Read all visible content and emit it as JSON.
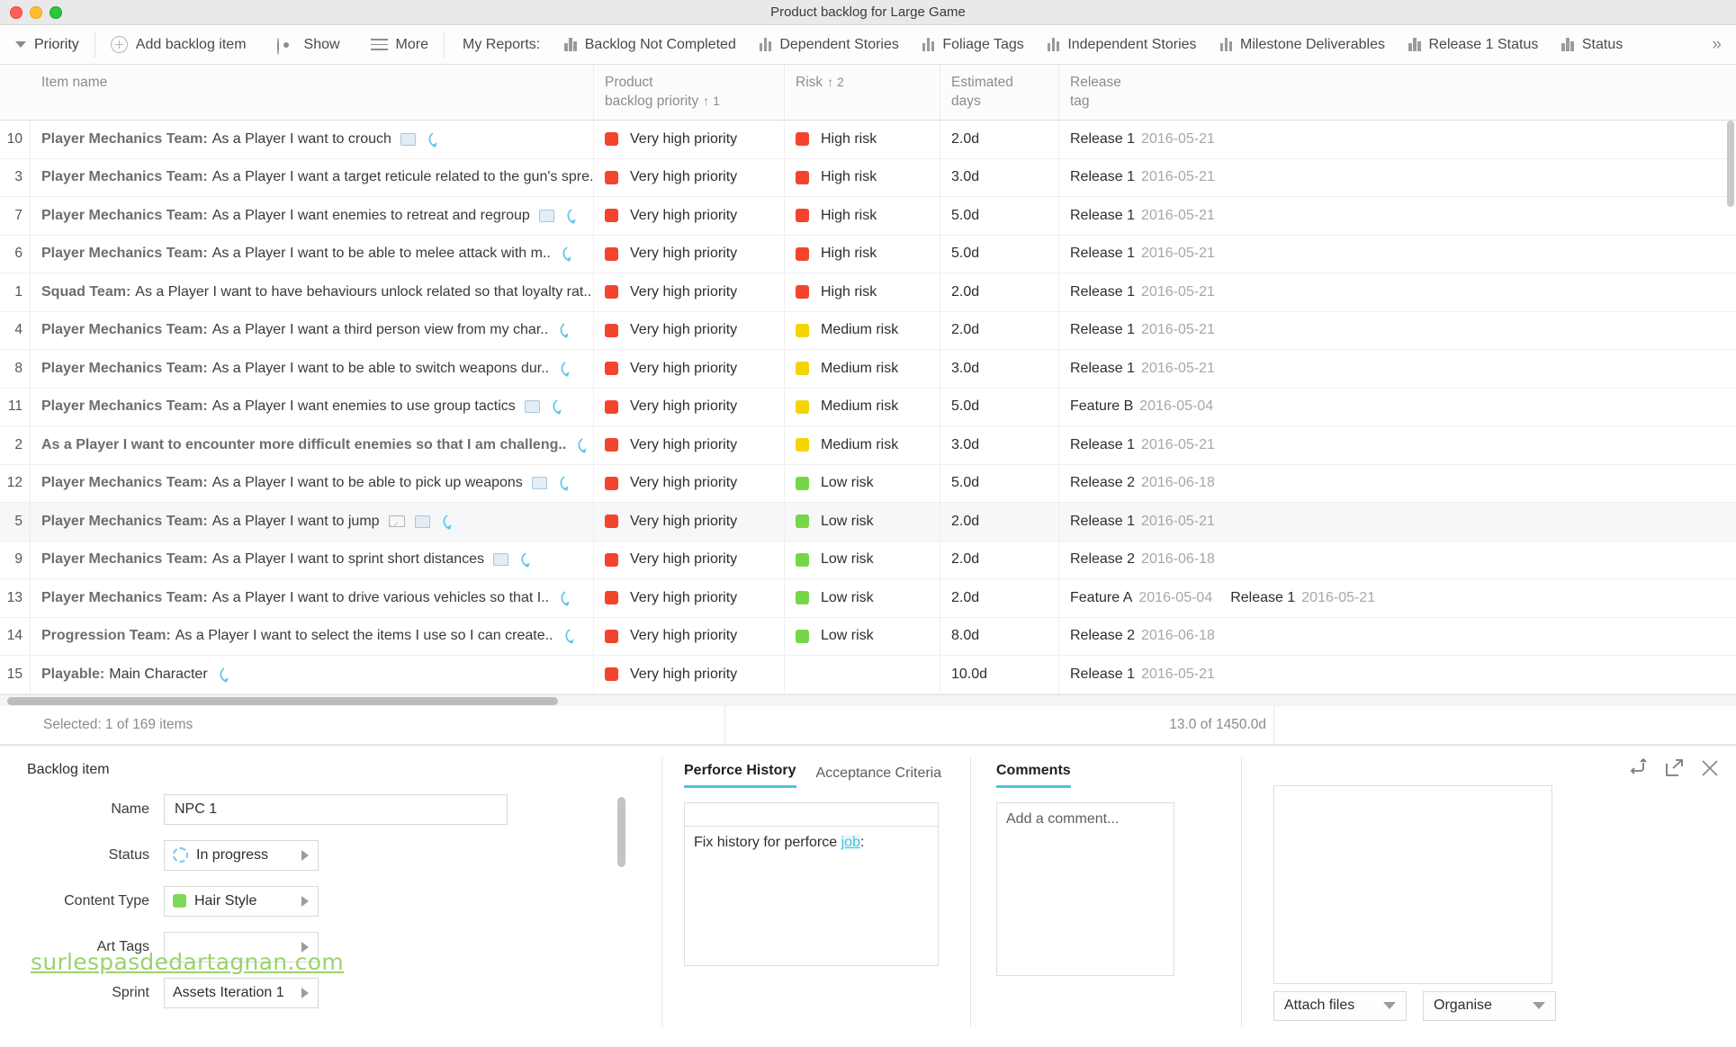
{
  "window": {
    "title": "Product backlog for Large Game"
  },
  "toolbar": {
    "priority_label": "Priority",
    "add_backlog_label": "Add backlog item",
    "show_label": "Show",
    "more_label": "More",
    "my_reports_label": "My Reports:",
    "overflow_label": "»",
    "reports": [
      {
        "label": "Backlog Not Completed"
      },
      {
        "label": "Dependent Stories"
      },
      {
        "label": "Foliage Tags"
      },
      {
        "label": "Independent Stories"
      },
      {
        "label": "Milestone Deliverables"
      },
      {
        "label": "Release 1 Status"
      },
      {
        "label": "Status"
      }
    ]
  },
  "table": {
    "columns": {
      "item_name": "Item name",
      "priority_l1": "Product",
      "priority_l2": "backlog priority",
      "priority_sort": "↑ 1",
      "risk": "Risk",
      "risk_sort": "↑ 2",
      "days_l1": "Estimated",
      "days_l2": "days",
      "release_l1": "Release",
      "release_l2": "tag"
    },
    "colors": {
      "very_high": "#f4442e",
      "high": "#f4442e",
      "medium": "#f5d500",
      "low": "#76d649"
    },
    "rows": [
      {
        "num": "10",
        "prefix": "Player Mechanics Team:",
        "rest": "As a Player I want to crouch",
        "allbold": false,
        "icons": [
          "note-icon",
          "arrow-icon"
        ],
        "priority": "Very high priority",
        "priority_color": "#f4442e",
        "risk": "High risk",
        "risk_color": "#f4442e",
        "days": "2.0d",
        "releases": [
          {
            "name": "Release 1",
            "date": "2016-05-21"
          }
        ]
      },
      {
        "num": "3",
        "prefix": "Player Mechanics Team:",
        "rest": "As a Player I want a target reticule related to the gun's spre..",
        "allbold": false,
        "icons": [],
        "priority": "Very high priority",
        "priority_color": "#f4442e",
        "risk": "High risk",
        "risk_color": "#f4442e",
        "days": "3.0d",
        "releases": [
          {
            "name": "Release 1",
            "date": "2016-05-21"
          }
        ]
      },
      {
        "num": "7",
        "prefix": "Player Mechanics Team:",
        "rest": "As a Player I want enemies to retreat and regroup",
        "allbold": false,
        "icons": [
          "note-icon",
          "arrow-icon"
        ],
        "priority": "Very high priority",
        "priority_color": "#f4442e",
        "risk": "High risk",
        "risk_color": "#f4442e",
        "days": "5.0d",
        "releases": [
          {
            "name": "Release 1",
            "date": "2016-05-21"
          }
        ]
      },
      {
        "num": "6",
        "prefix": "Player Mechanics Team:",
        "rest": "As a Player I want to be able to melee attack with m..",
        "allbold": false,
        "icons": [
          "arrow-icon"
        ],
        "priority": "Very high priority",
        "priority_color": "#f4442e",
        "risk": "High risk",
        "risk_color": "#f4442e",
        "days": "5.0d",
        "releases": [
          {
            "name": "Release 1",
            "date": "2016-05-21"
          }
        ]
      },
      {
        "num": "1",
        "prefix": "Squad Team:",
        "rest": "As a Player I want to have behaviours unlock related so that loyalty rat..",
        "allbold": false,
        "icons": [],
        "priority": "Very high priority",
        "priority_color": "#f4442e",
        "risk": "High risk",
        "risk_color": "#f4442e",
        "days": "2.0d",
        "releases": [
          {
            "name": "Release 1",
            "date": "2016-05-21"
          }
        ]
      },
      {
        "num": "4",
        "prefix": "Player Mechanics Team:",
        "rest": "As a Player I want a third person view from my char..",
        "allbold": false,
        "icons": [
          "arrow-icon"
        ],
        "priority": "Very high priority",
        "priority_color": "#f4442e",
        "risk": "Medium risk",
        "risk_color": "#f5d500",
        "days": "2.0d",
        "releases": [
          {
            "name": "Release 1",
            "date": "2016-05-21"
          }
        ]
      },
      {
        "num": "8",
        "prefix": "Player Mechanics Team:",
        "rest": "As a Player I want to be able to switch weapons dur..",
        "allbold": false,
        "icons": [
          "arrow-icon"
        ],
        "priority": "Very high priority",
        "priority_color": "#f4442e",
        "risk": "Medium risk",
        "risk_color": "#f5d500",
        "days": "3.0d",
        "releases": [
          {
            "name": "Release 1",
            "date": "2016-05-21"
          }
        ]
      },
      {
        "num": "11",
        "prefix": "Player Mechanics Team:",
        "rest": "As a Player I want enemies to use group tactics",
        "allbold": false,
        "icons": [
          "note-icon",
          "arrow-icon"
        ],
        "priority": "Very high priority",
        "priority_color": "#f4442e",
        "risk": "Medium risk",
        "risk_color": "#f5d500",
        "days": "5.0d",
        "releases": [
          {
            "name": "Feature B",
            "date": "2016-05-04"
          }
        ]
      },
      {
        "num": "2",
        "prefix": "",
        "rest": "As a Player I want to encounter more difficult enemies so that I am challeng..",
        "allbold": true,
        "icons": [
          "arrow-icon"
        ],
        "priority": "Very high priority",
        "priority_color": "#f4442e",
        "risk": "Medium risk",
        "risk_color": "#f5d500",
        "days": "3.0d",
        "releases": [
          {
            "name": "Release 1",
            "date": "2016-05-21"
          }
        ]
      },
      {
        "num": "12",
        "prefix": "Player Mechanics Team:",
        "rest": "As a Player I want to be able to pick up weapons",
        "allbold": false,
        "icons": [
          "note-icon",
          "arrow-icon"
        ],
        "priority": "Very high priority",
        "priority_color": "#f4442e",
        "risk": "Low risk",
        "risk_color": "#76d649",
        "days": "5.0d",
        "releases": [
          {
            "name": "Release 2",
            "date": "2016-06-18"
          }
        ]
      },
      {
        "num": "5",
        "prefix": "Player Mechanics Team:",
        "rest": "As a Player I want to jump",
        "allbold": false,
        "selected": true,
        "icons": [
          "mail-icon",
          "note-icon",
          "arrow-icon"
        ],
        "priority": "Very high priority",
        "priority_color": "#f4442e",
        "risk": "Low risk",
        "risk_color": "#76d649",
        "days": "2.0d",
        "releases": [
          {
            "name": "Release 1",
            "date": "2016-05-21"
          }
        ]
      },
      {
        "num": "9",
        "prefix": "Player Mechanics Team:",
        "rest": "As a Player I want to sprint short distances",
        "allbold": false,
        "icons": [
          "note-icon",
          "arrow-icon"
        ],
        "priority": "Very high priority",
        "priority_color": "#f4442e",
        "risk": "Low risk",
        "risk_color": "#76d649",
        "days": "2.0d",
        "releases": [
          {
            "name": "Release 2",
            "date": "2016-06-18"
          }
        ]
      },
      {
        "num": "13",
        "prefix": "Player Mechanics Team:",
        "rest": "As a Player I want to drive various vehicles so that I..",
        "allbold": false,
        "icons": [
          "arrow-icon"
        ],
        "priority": "Very high priority",
        "priority_color": "#f4442e",
        "risk": "Low risk",
        "risk_color": "#76d649",
        "days": "2.0d",
        "releases": [
          {
            "name": "Feature A",
            "date": "2016-05-04"
          },
          {
            "name": "Release 1",
            "date": "2016-05-21"
          }
        ]
      },
      {
        "num": "14",
        "prefix": "Progression Team:",
        "rest": "As a Player I want to select the items I use so I can create..",
        "allbold": false,
        "icons": [
          "arrow-icon"
        ],
        "priority": "Very high priority",
        "priority_color": "#f4442e",
        "risk": "Low risk",
        "risk_color": "#76d649",
        "days": "8.0d",
        "releases": [
          {
            "name": "Release 2",
            "date": "2016-06-18"
          }
        ]
      },
      {
        "num": "15",
        "prefix": "Playable:",
        "rest": "Main Character",
        "allbold": false,
        "icons": [
          "arrow-icon"
        ],
        "priority": "Very high priority",
        "priority_color": "#f4442e",
        "risk": "",
        "risk_color": "",
        "days": "10.0d",
        "releases": [
          {
            "name": "Release 1",
            "date": "2016-05-21"
          }
        ]
      }
    ]
  },
  "summary": {
    "selected_text": "Selected: 1 of 169 items",
    "days_total": "13.0 of 1450.0d"
  },
  "detail": {
    "panel_title": "Backlog item",
    "fields": {
      "name_label": "Name",
      "name_value": "NPC 1",
      "status_label": "Status",
      "status_value": "In progress",
      "content_type_label": "Content Type",
      "content_type_value": "Hair Style",
      "content_type_color": "#7ed957",
      "art_tags_label": "Art Tags",
      "art_tags_value": "",
      "sprint_label": "Sprint",
      "sprint_value": "Assets Iteration 1"
    },
    "history": {
      "tab_perforce": "Perforce History",
      "tab_acceptance": "Acceptance Criteria",
      "field_value": "",
      "body_prefix": "Fix history for perforce ",
      "body_link": "job",
      "body_suffix": ":"
    },
    "comments": {
      "heading": "Comments",
      "placeholder": "Add a comment..."
    },
    "attachments": {
      "attach_label": "Attach files",
      "organise_label": "Organise"
    },
    "watermark": "surlespasdedartagnan.com"
  }
}
